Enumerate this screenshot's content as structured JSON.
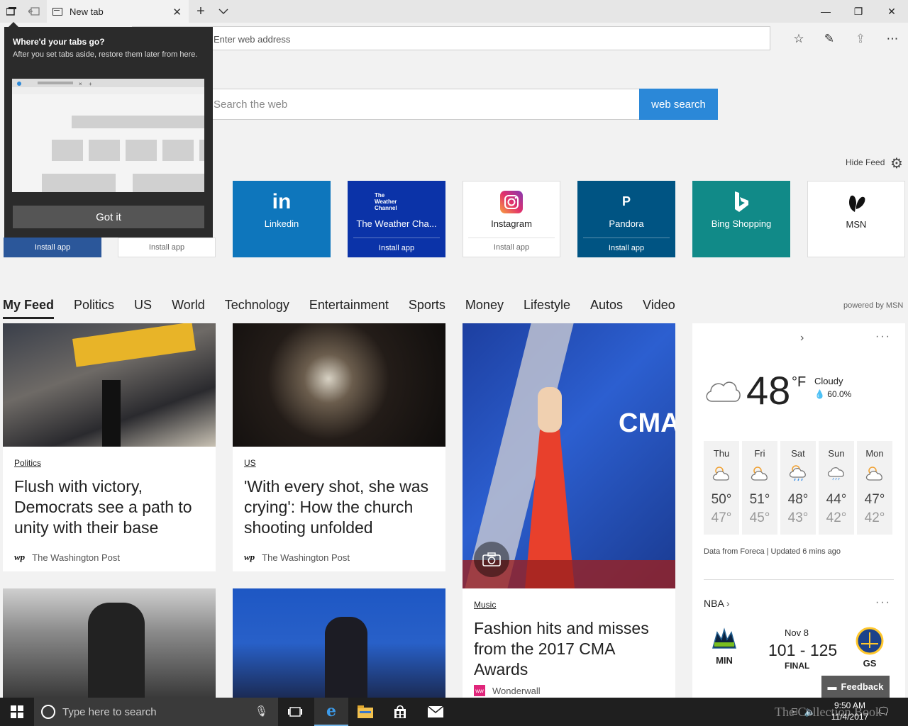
{
  "browser": {
    "tab_title": "New tab",
    "tab_close": "✕",
    "new_tab": "+",
    "tab_list": "⌵",
    "address_placeholder": "Enter web address",
    "window_controls": {
      "minimize": "—",
      "restore": "❐",
      "close": "✕"
    },
    "tools": {
      "favorites": "☆",
      "notes": "✎",
      "share": "⇪",
      "more": "⋯"
    }
  },
  "search": {
    "placeholder": "Search the web",
    "button": "web search"
  },
  "feed_controls": {
    "hide_feed": "Hide Feed"
  },
  "tiles": [
    {
      "label": "",
      "install": "Install app",
      "color": "#2b579a"
    },
    {
      "label": "",
      "install": "Install app",
      "color": "#ffffff"
    },
    {
      "label": "Linkedin",
      "logo": "in",
      "install": "",
      "color": "#0e76bc"
    },
    {
      "label": "The Weather Cha...",
      "logo": "The Weather Channel",
      "install": "Install app",
      "color": "#0b33a8"
    },
    {
      "label": "Instagram",
      "logo": "instagram-icon",
      "install": "Install app",
      "color": "#ffffff"
    },
    {
      "label": "Pandora",
      "logo": "P",
      "install": "Install app",
      "color": "#005483"
    },
    {
      "label": "Bing Shopping",
      "logo": "b",
      "install": "",
      "color": "#118a88"
    },
    {
      "label": "MSN",
      "logo": "msn-butterfly-icon",
      "install": "",
      "color": "#ffffff"
    }
  ],
  "popup": {
    "title": "Where'd your tabs go?",
    "description": "After you set tabs aside, restore them later from here.",
    "button": "Got it"
  },
  "feed_nav": {
    "items": [
      "My Feed",
      "Politics",
      "US",
      "World",
      "Technology",
      "Entertainment",
      "Sports",
      "Money",
      "Lifestyle",
      "Autos",
      "Video"
    ],
    "active": "My Feed",
    "powered_by": "powered by MSN"
  },
  "articles": [
    {
      "category": "Politics",
      "title": "Flush with victory, Democrats see a path to unity with their base",
      "source": "The Washington Post",
      "source_logo": "wp"
    },
    {
      "category": "US",
      "title": "'With every shot, she was crying': How the church shooting unfolded",
      "source": "The Washington Post",
      "source_logo": "wp"
    },
    {
      "category": "Music",
      "title": "Fashion hits and misses from the 2017 CMA Awards",
      "source": "Wonderwall",
      "source_logo": "ww"
    }
  ],
  "weather": {
    "temp": "48",
    "unit": "°F",
    "condition": "Cloudy",
    "precip": "60.0%",
    "forecast": [
      {
        "day": "Thu",
        "hi": "50°",
        "lo": "47°",
        "icon": "partly-sunny-icon"
      },
      {
        "day": "Fri",
        "hi": "51°",
        "lo": "45°",
        "icon": "partly-sunny-icon"
      },
      {
        "day": "Sat",
        "hi": "48°",
        "lo": "43°",
        "icon": "sun-rain-icon"
      },
      {
        "day": "Sun",
        "hi": "44°",
        "lo": "42°",
        "icon": "rain-cloud-icon"
      },
      {
        "day": "Mon",
        "hi": "47°",
        "lo": "42°",
        "icon": "partly-sunny-icon"
      }
    ],
    "footer": "Data from Foreca | Updated 6 mins ago"
  },
  "nba": {
    "title": "NBA",
    "home": "MIN",
    "away": "GS",
    "date": "Nov 8",
    "score": "101 - 125",
    "status": "FINAL"
  },
  "feedback": "Feedback",
  "taskbar": {
    "search_placeholder": "Type here to search",
    "time": "9:50 AM",
    "date": "11/4/2017"
  },
  "watermark": "The Collection Book"
}
